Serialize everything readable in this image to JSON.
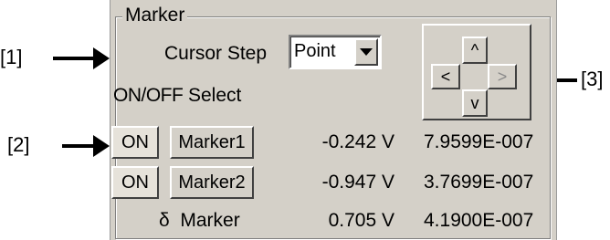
{
  "callouts": {
    "one": "[1]",
    "two": "[2]",
    "three": "[3]"
  },
  "marker_group": {
    "title": "Marker",
    "cursor_step_label": "Cursor Step",
    "cursor_step_value": "Point",
    "onoff_label": "ON/OFF",
    "select_label": "Select",
    "cursor_buttons": {
      "up": "^",
      "left": "<",
      "right": ">",
      "down": "v"
    },
    "rows": [
      {
        "on_label": "ON",
        "marker_label": "Marker1",
        "voltage": "-0.242 V",
        "time": "7.9599E-007"
      },
      {
        "on_label": "ON",
        "marker_label": "Marker2",
        "voltage": "-0.947 V",
        "time": "3.7699E-007"
      }
    ],
    "delta": {
      "label": "δ  Marker",
      "voltage": "0.705 V",
      "time": "4.1900E-007"
    }
  },
  "colors": {
    "panel_bg": "#d4d0c8",
    "arrow": "#000000"
  }
}
